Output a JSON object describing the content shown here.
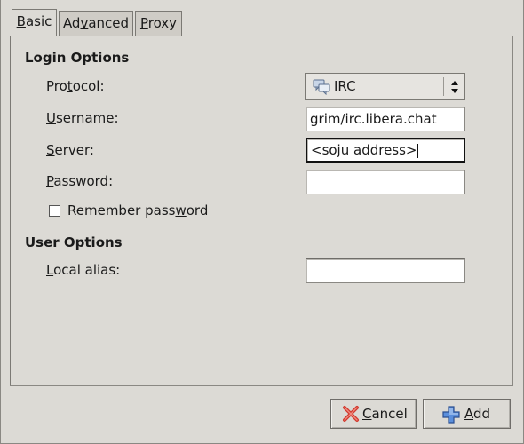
{
  "tabs": [
    {
      "label_pre": "",
      "label_mn": "B",
      "label_post": "asic",
      "active": true
    },
    {
      "label_pre": "Ad",
      "label_mn": "v",
      "label_post": "anced",
      "active": false
    },
    {
      "label_pre": "",
      "label_mn": "P",
      "label_post": "roxy",
      "active": false
    }
  ],
  "login": {
    "heading": "Login Options",
    "protocol": {
      "pre": "Pro",
      "mn": "t",
      "post": "ocol:",
      "value": "IRC",
      "icon": "chat-bubbles-icon"
    },
    "username": {
      "pre": "",
      "mn": "U",
      "post": "sername:",
      "value": "grim/irc.libera.chat"
    },
    "server": {
      "pre": "",
      "mn": "S",
      "post": "erver:",
      "value": "<soju address>"
    },
    "password": {
      "pre": "",
      "mn": "P",
      "post": "assword:",
      "value": ""
    },
    "remember": {
      "pre": "Remember pass",
      "mn": "w",
      "post": "ord",
      "checked": false
    }
  },
  "user": {
    "heading": "User Options",
    "alias": {
      "pre": "",
      "mn": "L",
      "post": "ocal alias:",
      "value": ""
    }
  },
  "buttons": {
    "cancel": {
      "mn": "C",
      "post": "ancel",
      "icon": "red-x-icon"
    },
    "add": {
      "mn": "A",
      "post": "dd",
      "icon": "blue-plus-icon"
    }
  },
  "colors": {
    "window_bg": "#dcdad5",
    "cancel_icon": "#d23a2f",
    "add_icon": "#3b6fc8"
  }
}
